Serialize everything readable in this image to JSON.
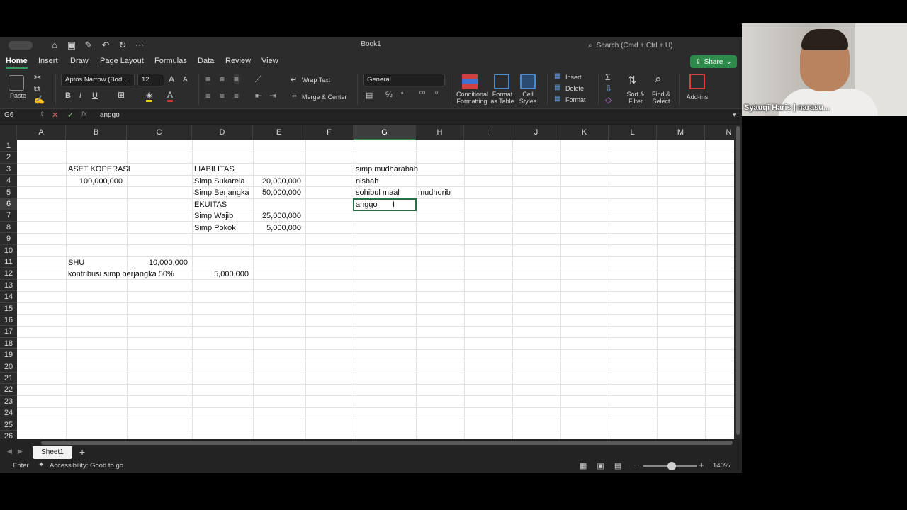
{
  "window": {
    "title": "Book1",
    "search_placeholder": "Search (Cmd + Ctrl + U)"
  },
  "tabs": [
    "Home",
    "Insert",
    "Draw",
    "Page Layout",
    "Formulas",
    "Data",
    "Review",
    "View"
  ],
  "share_label": "Share",
  "ribbon": {
    "paste": "Paste",
    "font_name": "Aptos Narrow (Bod...",
    "font_size": "12",
    "wrap_text": "Wrap Text",
    "merge_center": "Merge & Center",
    "number_format": "General",
    "conditional_formatting_1": "Conditional",
    "conditional_formatting_2": "Formatting",
    "format_table_1": "Format",
    "format_table_2": "as Table",
    "cell_styles_1": "Cell",
    "cell_styles_2": "Styles",
    "insert": "Insert",
    "delete": "Delete",
    "format": "Format",
    "sort_filter_1": "Sort &",
    "sort_filter_2": "Filter",
    "find_select_1": "Find &",
    "find_select_2": "Select",
    "addins": "Add-ins",
    "bold": "B",
    "italic": "I",
    "underline": "U",
    "percent": "%"
  },
  "formula_bar": {
    "name_box": "G6",
    "fx": "fx",
    "value": "anggo"
  },
  "columns": [
    "A",
    "B",
    "C",
    "D",
    "E",
    "F",
    "G",
    "H",
    "I",
    "J",
    "K",
    "L",
    "M",
    "N"
  ],
  "rows": [
    "1",
    "2",
    "3",
    "4",
    "5",
    "6",
    "7",
    "8",
    "9",
    "10",
    "11",
    "12",
    "13",
    "14",
    "15",
    "16",
    "17",
    "18",
    "19",
    "20",
    "21",
    "22",
    "23",
    "24",
    "25",
    "26"
  ],
  "cells": {
    "B3": "ASET KOPERASI",
    "B4": "100,000,000",
    "D3": "LIABILITAS",
    "D4": "Simp Sukarela",
    "E4": "20,000,000",
    "D5": "Simp Berjangka",
    "E5": "50,000,000",
    "D6": "EKUITAS",
    "D7": "Simp Wajib",
    "E7": "25,000,000",
    "D8": "Simp Pokok",
    "E8": "5,000,000",
    "G3": "simp mudharabah",
    "G4": "nisbah",
    "G5": "sohibul maal",
    "H5": "mudhorib",
    "G6": "anggo",
    "B11": "SHU",
    "C11": "10,000,000",
    "B12": "kontribusi simp berjangka 50%",
    "D12": "5,000,000"
  },
  "sheet_tab": "Sheet1",
  "status": {
    "mode": "Enter",
    "accessibility": "Accessibility: Good to go",
    "zoom": "140%"
  },
  "webcam": {
    "name": "Syauqi Haris | narasu..."
  },
  "colors": {
    "accent": "#2e8a4a",
    "active_cell": "#217346"
  }
}
